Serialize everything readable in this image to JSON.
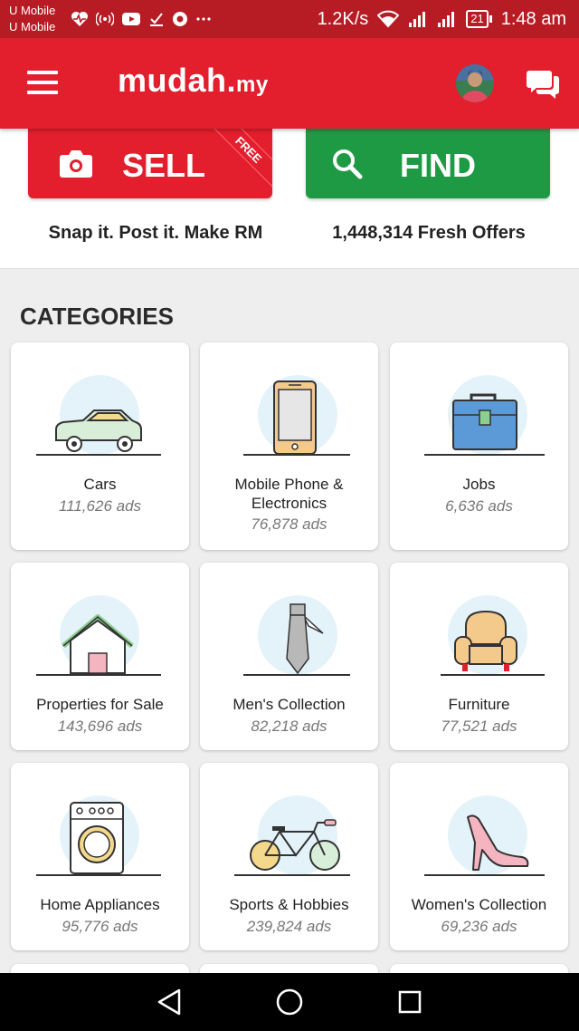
{
  "status_bar": {
    "carrier_1": "U Mobile",
    "carrier_2": "U Mobile",
    "speed": "1.2K/s",
    "battery": "21",
    "time": "1:48 am",
    "icons": [
      "heart-rate-icon",
      "hotspot-icon",
      "youtube-icon",
      "download-check-icon",
      "chrome-icon",
      "more-icon",
      "wifi-icon",
      "signal-icon",
      "signal-icon",
      "battery-icon"
    ]
  },
  "app_bar": {
    "logo_main": "mudah.",
    "logo_suffix": "my",
    "menu_icon": "hamburger-menu-icon",
    "chat_icon": "chat-bubbles-icon",
    "brand_color": "#e31e2d"
  },
  "hero": {
    "sell_label": "SELL",
    "sell_badge": "FREE",
    "sell_tagline": "Snap it. Post it. Make RM",
    "find_label": "FIND",
    "find_tagline": "1,448,314 Fresh Offers",
    "sell_color": "#e31e2d",
    "find_color": "#1e9a45"
  },
  "categories": {
    "title": "CATEGORIES",
    "items": [
      {
        "name": "Cars",
        "count": "111,626 ads",
        "icon": "car-icon"
      },
      {
        "name": "Mobile Phone & Electronics",
        "count": "76,878 ads",
        "icon": "mobile-phone-icon"
      },
      {
        "name": "Jobs",
        "count": "6,636 ads",
        "icon": "briefcase-icon"
      },
      {
        "name": "Properties for Sale",
        "count": "143,696 ads",
        "icon": "house-icon"
      },
      {
        "name": "Men's Collection",
        "count": "82,218 ads",
        "icon": "necktie-icon"
      },
      {
        "name": "Furniture",
        "count": "77,521 ads",
        "icon": "armchair-icon"
      },
      {
        "name": "Home Appliances",
        "count": "95,776 ads",
        "icon": "washing-machine-icon"
      },
      {
        "name": "Sports & Hobbies",
        "count": "239,824 ads",
        "icon": "bicycle-icon"
      },
      {
        "name": "Women's Collection",
        "count": "69,236 ads",
        "icon": "high-heel-icon"
      }
    ]
  },
  "nav_bar": {
    "icons": [
      "back-icon",
      "home-icon",
      "recents-icon"
    ]
  }
}
